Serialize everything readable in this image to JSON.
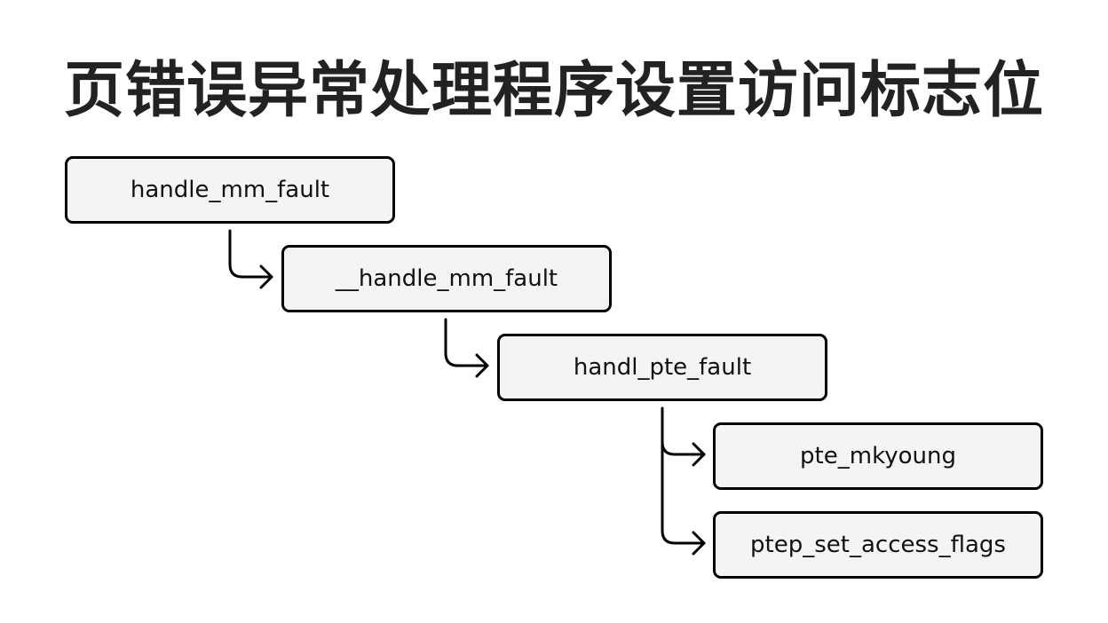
{
  "title": "页错误异常处理程序设置访问标志位",
  "nodes": [
    {
      "id": "handle_mm_fault",
      "label": "handle_mm_fault"
    },
    {
      "id": "__handle_mm_fault",
      "label": "__handle_mm_fault"
    },
    {
      "id": "handl_pte_fault",
      "label": "handl_pte_fault"
    },
    {
      "id": "pte_mkyoung",
      "label": "pte_mkyoung"
    },
    {
      "id": "ptep_set_access_flags",
      "label": "ptep_set_access_flags"
    }
  ],
  "edges": [
    {
      "from": "handle_mm_fault",
      "to": "__handle_mm_fault"
    },
    {
      "from": "__handle_mm_fault",
      "to": "handl_pte_fault"
    },
    {
      "from": "handl_pte_fault",
      "to": "pte_mkyoung"
    },
    {
      "from": "handl_pte_fault",
      "to": "ptep_set_access_flags"
    }
  ],
  "colors": {
    "box_fill": "#f4f4f4",
    "border": "#000000",
    "title": "#222222"
  }
}
